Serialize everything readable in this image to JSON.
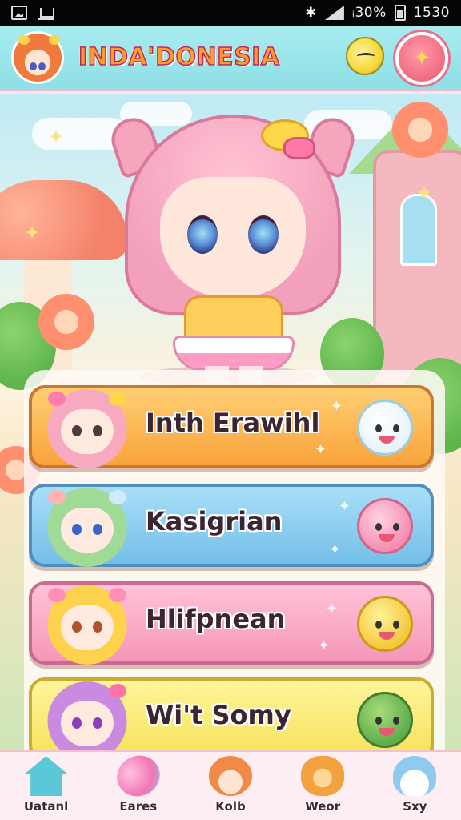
{
  "status_bar": {
    "signal_text": "ᵢ𝑙𝑙",
    "battery_text": "ᵢ30%",
    "time": "1530"
  },
  "header": {
    "title": "INDA'DONESIA",
    "menu_icon": "sparkle-icon"
  },
  "menu_items": [
    {
      "label": "Inth Erawihl",
      "color": "#f9a33c",
      "pet": "ghost-cat-pet"
    },
    {
      "label": "Kasigrian",
      "color": "#74bfe8",
      "pet": "pink-blob-pet"
    },
    {
      "label": "Hlifpnean",
      "color": "#f596b8",
      "pet": "yellow-cat-pet"
    },
    {
      "label": "Wi't Somy",
      "color": "#f6e15a",
      "pet": "green-frog-pet"
    }
  ],
  "bottom_nav": [
    {
      "label": "Uatanl",
      "icon": "home-icon"
    },
    {
      "label": "Eares",
      "icon": "potion-icon"
    },
    {
      "label": "Kolb",
      "icon": "character-icon"
    },
    {
      "label": "Weor",
      "icon": "bear-icon"
    },
    {
      "label": "Sxy",
      "icon": "slime-icon"
    }
  ]
}
